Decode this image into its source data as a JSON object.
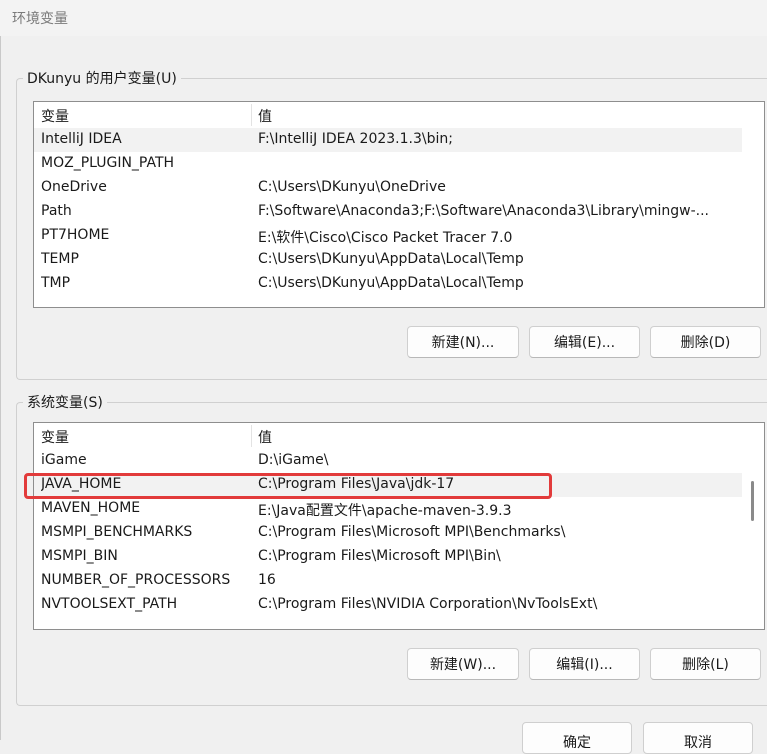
{
  "window": {
    "title": "环境变量"
  },
  "user_vars": {
    "legend": "DKunyu 的用户变量(U)",
    "columns": {
      "name": "变量",
      "value": "值"
    },
    "rows": [
      {
        "name": "IntelliJ IDEA",
        "value": "F:\\IntelliJ IDEA 2023.1.3\\bin;"
      },
      {
        "name": "MOZ_PLUGIN_PATH",
        "value": ""
      },
      {
        "name": "OneDrive",
        "value": "C:\\Users\\DKunyu\\OneDrive"
      },
      {
        "name": "Path",
        "value": "F:\\Software\\Anaconda3;F:\\Software\\Anaconda3\\Library\\mingw-..."
      },
      {
        "name": "PT7HOME",
        "value": "E:\\软件\\Cisco\\Cisco Packet Tracer 7.0"
      },
      {
        "name": "TEMP",
        "value": "C:\\Users\\DKunyu\\AppData\\Local\\Temp"
      },
      {
        "name": "TMP",
        "value": "C:\\Users\\DKunyu\\AppData\\Local\\Temp"
      }
    ],
    "buttons": {
      "new": "新建(N)...",
      "edit": "编辑(E)...",
      "delete": "删除(D)"
    }
  },
  "system_vars": {
    "legend": "系统变量(S)",
    "columns": {
      "name": "变量",
      "value": "值"
    },
    "rows": [
      {
        "name": "iGame",
        "value": "D:\\iGame\\"
      },
      {
        "name": "JAVA_HOME",
        "value": "C:\\Program Files\\Java\\jdk-17"
      },
      {
        "name": "MAVEN_HOME",
        "value": "E:\\Java配置文件\\apache-maven-3.9.3"
      },
      {
        "name": "MSMPI_BENCHMARKS",
        "value": "C:\\Program Files\\Microsoft MPI\\Benchmarks\\"
      },
      {
        "name": "MSMPI_BIN",
        "value": "C:\\Program Files\\Microsoft MPI\\Bin\\"
      },
      {
        "name": "NUMBER_OF_PROCESSORS",
        "value": "16"
      },
      {
        "name": "NVTOOLSEXT_PATH",
        "value": "C:\\Program Files\\NVIDIA Corporation\\NvToolsExt\\"
      }
    ],
    "buttons": {
      "new": "新建(W)...",
      "edit": "编辑(I)...",
      "delete": "删除(L)"
    }
  },
  "dialog_buttons": {
    "ok": "确定",
    "cancel": "取消"
  },
  "colors": {
    "highlight": "#e23b3b",
    "selected_row": "#f2f2f2"
  }
}
